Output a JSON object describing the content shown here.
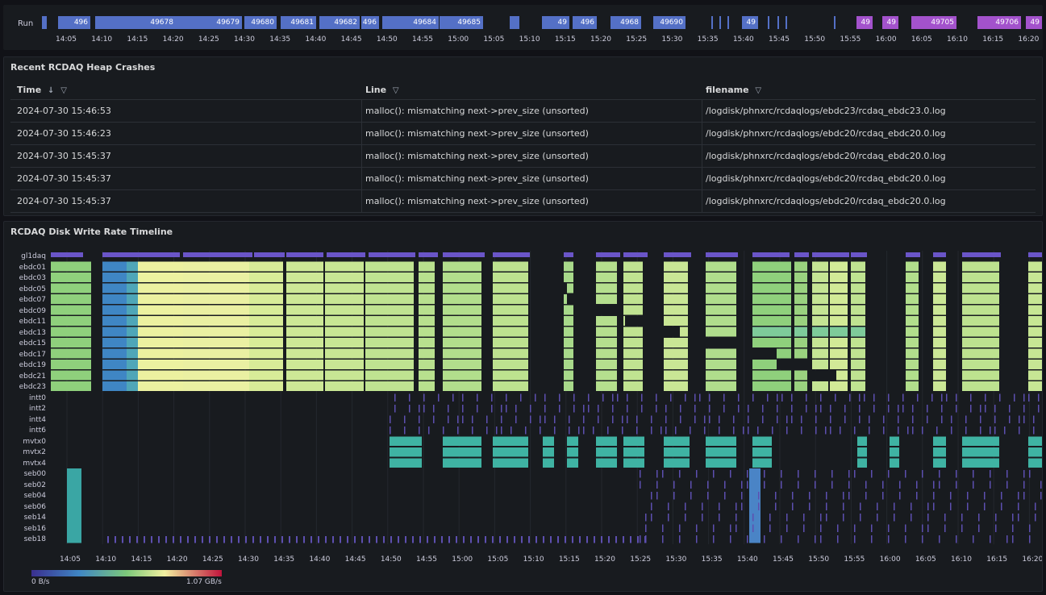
{
  "run_panel": {
    "label": "Run",
    "segments": [
      {
        "label": "",
        "color": "#5470c6"
      },
      {
        "label": "496",
        "color": "#5470c6"
      },
      {
        "label": "49678",
        "color": "#5470c6"
      },
      {
        "label": "49679",
        "color": "#5470c6"
      },
      {
        "label": "49680",
        "color": "#5470c6"
      },
      {
        "label": "49681",
        "color": "#5470c6"
      },
      {
        "label": "49682",
        "color": "#5470c6"
      },
      {
        "label": "496",
        "color": "#5470c6"
      },
      {
        "label": "49684",
        "color": "#5470c6"
      },
      {
        "label": "49685",
        "color": "#5470c6"
      },
      {
        "label": "",
        "color": "#5470c6"
      },
      {
        "label": "49",
        "color": "#5470c6"
      },
      {
        "label": "496",
        "color": "#5470c6"
      },
      {
        "label": "4968",
        "color": "#5470c6"
      },
      {
        "label": "49690",
        "color": "#5470c6"
      },
      {
        "label": "49",
        "color": "#5470c6"
      },
      {
        "label": "49",
        "color": "#a352cc"
      },
      {
        "label": "49",
        "color": "#a352cc"
      },
      {
        "label": "49705",
        "color": "#a352cc"
      },
      {
        "label": "49706",
        "color": "#a352cc"
      },
      {
        "label": "49",
        "color": "#a352cc"
      }
    ],
    "ticks": [
      "14:05",
      "14:10",
      "14:15",
      "14:20",
      "14:25",
      "14:30",
      "14:35",
      "14:40",
      "14:45",
      "14:50",
      "14:55",
      "15:00",
      "15:05",
      "15:10",
      "15:15",
      "15:20",
      "15:25",
      "15:30",
      "15:35",
      "15:40",
      "15:45",
      "15:50",
      "15:55",
      "16:00",
      "16:05",
      "16:10",
      "16:15",
      "16:20"
    ]
  },
  "table_panel": {
    "title": "Recent RCDAQ Heap Crashes",
    "columns": [
      {
        "label": "Time",
        "sort": "↓",
        "filter": "funnel-icon"
      },
      {
        "label": "Line",
        "filter": "funnel-icon"
      },
      {
        "label": "filename",
        "filter": "funnel-icon"
      }
    ],
    "rows": [
      [
        "2024-07-30 15:46:53",
        "malloc(): mismatching next->prev_size (unsorted)",
        "/logdisk/phnxrc/rcdaqlogs/ebdc23/rcdaq_ebdc23.0.log"
      ],
      [
        "2024-07-30 15:46:23",
        "malloc(): mismatching next->prev_size (unsorted)",
        "/logdisk/phnxrc/rcdaqlogs/ebdc20/rcdaq_ebdc20.0.log"
      ],
      [
        "2024-07-30 15:45:37",
        "malloc(): mismatching next->prev_size (unsorted)",
        "/logdisk/phnxrc/rcdaqlogs/ebdc20/rcdaq_ebdc20.0.log"
      ],
      [
        "2024-07-30 15:45:37",
        "malloc(): mismatching next->prev_size (unsorted)",
        "/logdisk/phnxrc/rcdaqlogs/ebdc20/rcdaq_ebdc20.0.log"
      ],
      [
        "2024-07-30 15:45:37",
        "malloc(): mismatching next->prev_size (unsorted)",
        "/logdisk/phnxrc/rcdaqlogs/ebdc20/rcdaq_ebdc20.0.log"
      ]
    ]
  },
  "timeline_panel": {
    "title": "RCDAQ Disk Write Rate Timeline",
    "row_labels": [
      "gl1daq",
      "ebdc01",
      "ebdc03",
      "ebdc05",
      "ebdc07",
      "ebdc09",
      "ebdc11",
      "ebdc13",
      "ebdc15",
      "ebdc17",
      "ebdc19",
      "ebdc21",
      "ebdc23",
      "intt0",
      "intt2",
      "intt4",
      "intt6",
      "mvtx0",
      "mvtx2",
      "mvtx4",
      "seb00",
      "seb02",
      "seb04",
      "seb06",
      "seb14",
      "seb16",
      "seb18"
    ],
    "ticks": [
      "14:05",
      "14:10",
      "14:15",
      "14:20",
      "14:25",
      "14:30",
      "14:35",
      "14:40",
      "14:45",
      "14:50",
      "14:55",
      "15:00",
      "15:05",
      "15:10",
      "15:15",
      "15:20",
      "15:25",
      "15:30",
      "15:35",
      "15:40",
      "15:45",
      "15:50",
      "15:55",
      "16:00",
      "16:05",
      "16:10",
      "16:15",
      "16:20"
    ],
    "legend_min": "0 B/s",
    "legend_max": "1.07 GB/s"
  }
}
